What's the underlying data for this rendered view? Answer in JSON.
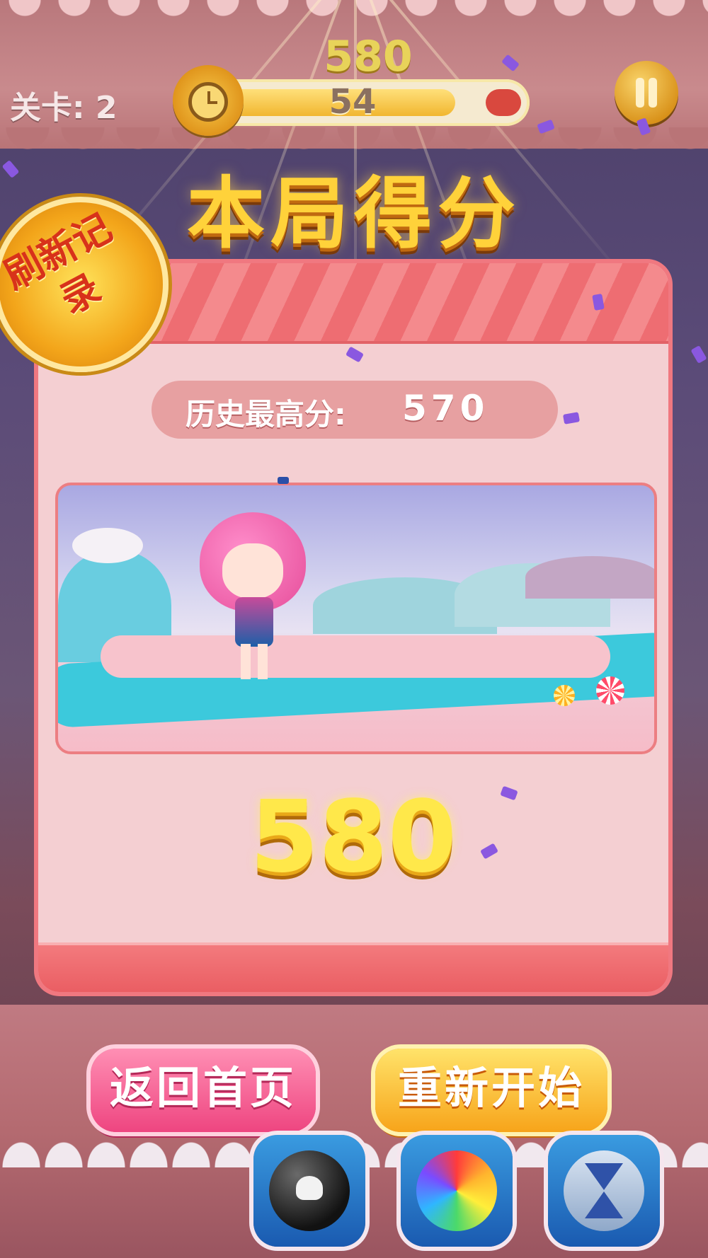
{
  "hud": {
    "top_score": "580",
    "level_label": "关卡: 2",
    "timer_value": "54",
    "timer_progress": 0.9
  },
  "result": {
    "title": "本局得分",
    "badge": "刷新记录",
    "best_label": "历史最高分:",
    "best_value": "570",
    "final_score": "580"
  },
  "buttons": {
    "home": "返回首页",
    "restart": "重新开始"
  },
  "powerups": [
    {
      "name": "bomb-icon"
    },
    {
      "name": "rainbow-ball-icon"
    },
    {
      "name": "hourglass-icon"
    }
  ],
  "colors": {
    "gold_text": "#ffd23a",
    "panel_pink": "#f4cfd2",
    "home_button": "#ee4580",
    "restart_button": "#f7a41a"
  }
}
